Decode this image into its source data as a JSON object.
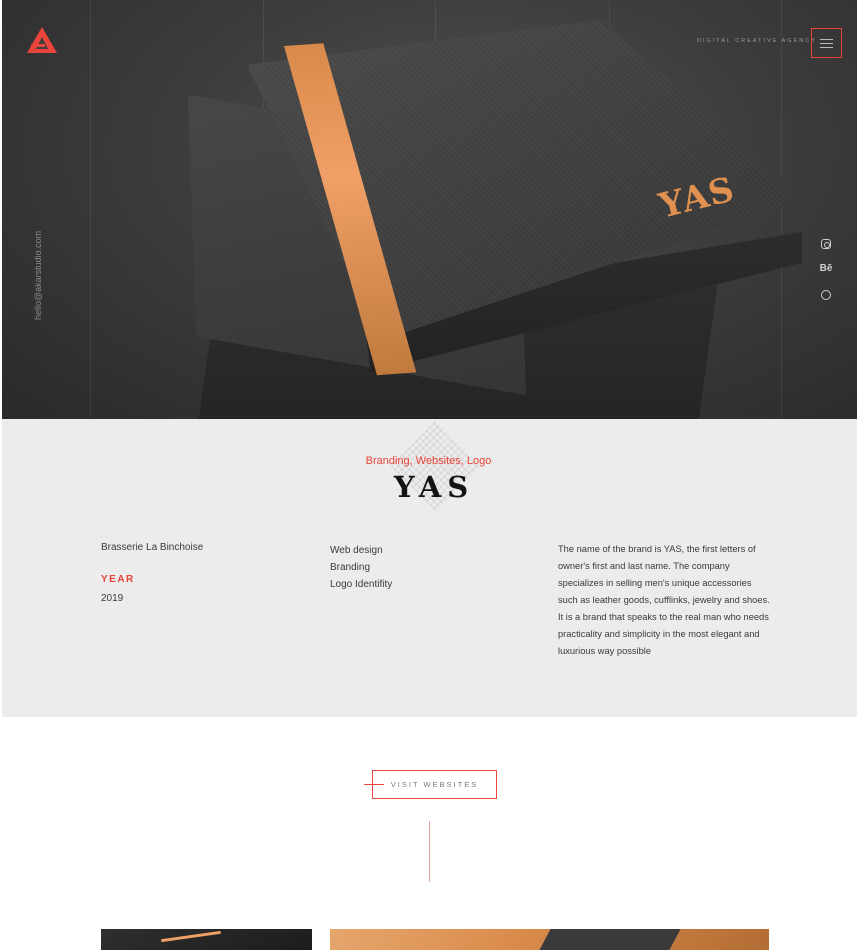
{
  "hero": {
    "agency_label": "DIGITAL CREATIVE AGENCY",
    "email": "hello@akarstudio.com",
    "brand_mark": "YAS",
    "social": {
      "instagram_icon": "instagram-icon",
      "behance_label": "Bē",
      "dribbble_icon": "dribbble-icon"
    },
    "colors": {
      "accent": "#e8443a",
      "stripe": "#f0a067"
    }
  },
  "project": {
    "tags": "Branding, Websites, Logo",
    "title": "YAS",
    "client": "Brasserie La Binchoise",
    "year_label": "YEAR",
    "year": "2019",
    "services": [
      "Web design",
      "Branding",
      "Logo Identifity"
    ],
    "description": "The name of the brand is YAS, the first letters of owner's first and last name. The company specializes in selling men's unique accessories such as leather goods, cufflinks, jewelry and shoes. It is a brand that speaks to the real man who needs practicality and simplicity in the most elegant and luxurious way possible"
  },
  "cta": {
    "visit_label": "VISIT WEBSITES"
  }
}
